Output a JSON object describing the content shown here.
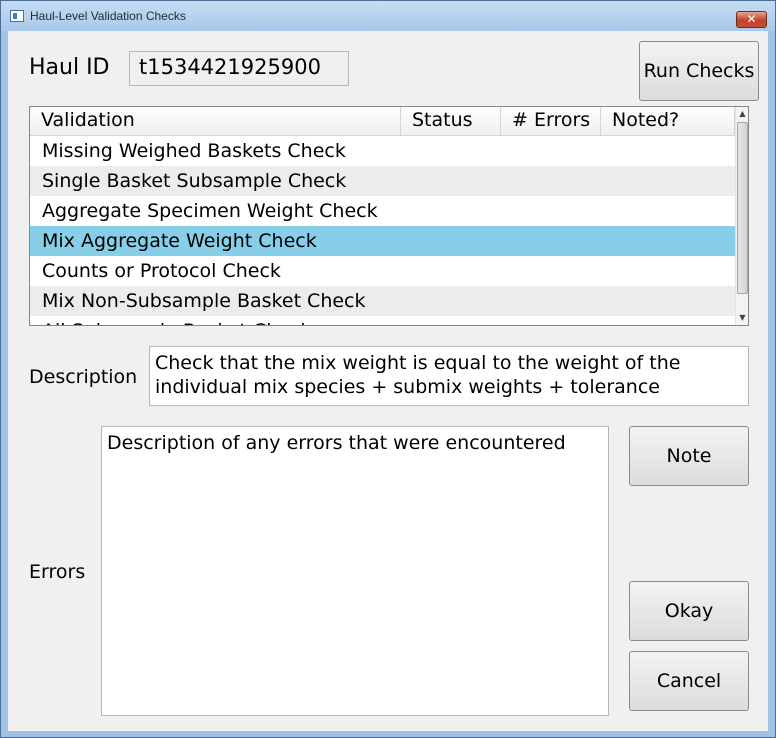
{
  "window": {
    "title": "Haul-Level Validation Checks",
    "close_glyph": "✕"
  },
  "haul": {
    "label": "Haul ID",
    "value": "t1534421925900"
  },
  "run_checks_label": "Run Checks",
  "table": {
    "headers": [
      "Validation",
      "Status",
      "# Errors",
      "Noted?"
    ],
    "rows": [
      {
        "validation": "Missing Weighed Baskets Check",
        "status": "",
        "errors": "",
        "noted": ""
      },
      {
        "validation": "Single Basket Subsample Check",
        "status": "",
        "errors": "",
        "noted": ""
      },
      {
        "validation": "Aggregate Specimen Weight Check",
        "status": "",
        "errors": "",
        "noted": ""
      },
      {
        "validation": "Mix Aggregate Weight Check",
        "status": "",
        "errors": "",
        "noted": "",
        "selected": true
      },
      {
        "validation": "Counts or Protocol Check",
        "status": "",
        "errors": "",
        "noted": ""
      },
      {
        "validation": "Mix Non-Subsample Basket Check",
        "status": "",
        "errors": "",
        "noted": ""
      },
      {
        "validation": "All Subsample Basket Check",
        "status": "",
        "errors": "",
        "noted": ""
      }
    ]
  },
  "description": {
    "label": "Description",
    "text": "Check that the mix weight is equal to the weight of the individual mix species + submix weights + tolerance"
  },
  "errors": {
    "label": "Errors",
    "text": "Description of any errors that were encountered"
  },
  "buttons": {
    "note": "Note",
    "okay": "Okay",
    "cancel": "Cancel"
  },
  "scrollbar": {
    "up_icon": "▲",
    "down_icon": "▼"
  },
  "colors": {
    "selection": "#87cfe9",
    "alt_row": "#ececec",
    "dialog_bg": "#f0f0f0",
    "close_red": "#c2432d"
  }
}
